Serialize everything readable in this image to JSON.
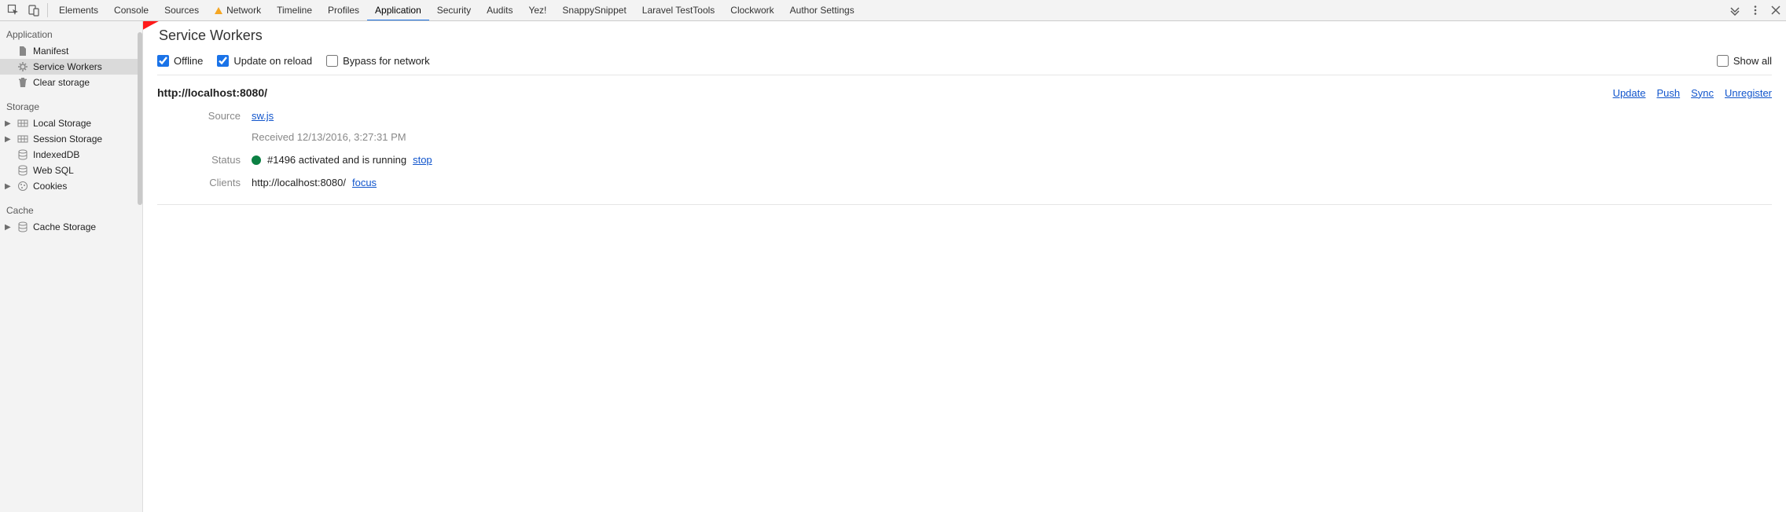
{
  "tabs": [
    "Elements",
    "Console",
    "Sources",
    "Network",
    "Timeline",
    "Profiles",
    "Application",
    "Security",
    "Audits",
    "Yez!",
    "SnappySnippet",
    "Laravel TestTools",
    "Clockwork",
    "Author Settings"
  ],
  "active_tab_index": 6,
  "warn_tab_index": 3,
  "sidebar": {
    "groups": [
      {
        "title": "Application",
        "items": [
          {
            "label": "Manifest",
            "icon": "file-icon"
          },
          {
            "label": "Service Workers",
            "icon": "gear-icon",
            "selected": true
          },
          {
            "label": "Clear storage",
            "icon": "trash-icon"
          }
        ]
      },
      {
        "title": "Storage",
        "items": [
          {
            "label": "Local Storage",
            "icon": "table-icon",
            "expandable": true
          },
          {
            "label": "Session Storage",
            "icon": "table-icon",
            "expandable": true
          },
          {
            "label": "IndexedDB",
            "icon": "db-icon"
          },
          {
            "label": "Web SQL",
            "icon": "db-icon"
          },
          {
            "label": "Cookies",
            "icon": "cookie-icon",
            "expandable": true
          }
        ]
      },
      {
        "title": "Cache",
        "items": [
          {
            "label": "Cache Storage",
            "icon": "db-icon",
            "expandable": true
          }
        ]
      }
    ]
  },
  "main": {
    "title": "Service Workers",
    "options": {
      "offline": {
        "label": "Offline",
        "checked": true
      },
      "update_on_reload": {
        "label": "Update on reload",
        "checked": true
      },
      "bypass": {
        "label": "Bypass for network",
        "checked": false
      },
      "show_all": {
        "label": "Show all",
        "checked": false
      }
    },
    "worker": {
      "origin": "http://localhost:8080/",
      "actions": {
        "update": "Update",
        "push": "Push",
        "sync": "Sync",
        "unregister": "Unregister"
      },
      "source": {
        "label": "Source",
        "file": "sw.js",
        "received": "Received 12/13/2016, 3:27:31 PM"
      },
      "status": {
        "label": "Status",
        "text": "#1496 activated and is running",
        "stop": "stop"
      },
      "clients": {
        "label": "Clients",
        "url": "http://localhost:8080/",
        "focus": "focus"
      }
    }
  }
}
